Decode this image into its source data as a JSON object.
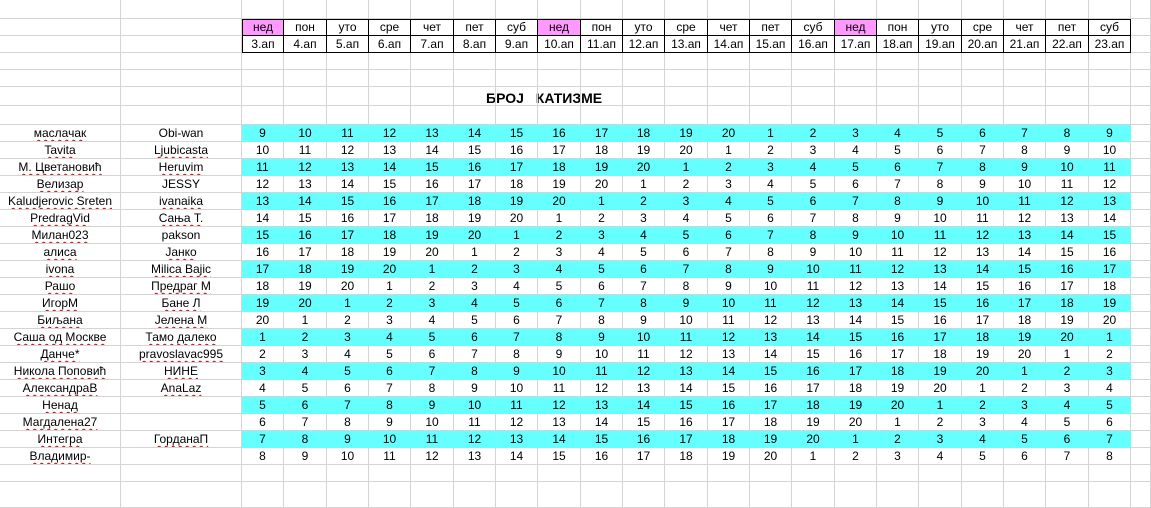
{
  "header": {
    "weekdays": [
      "нед",
      "пон",
      "уто",
      "сре",
      "чет",
      "пет",
      "суб",
      "нед",
      "пон",
      "уто",
      "сре",
      "чет",
      "пет",
      "суб",
      "нед",
      "пон",
      "уто",
      "сре",
      "чет",
      "пет",
      "суб"
    ],
    "dates": [
      "3.ап",
      "4.ап",
      "5.ап",
      "6.ап",
      "7.ап",
      "8.ап",
      "9.ап",
      "10.ап",
      "11.ап",
      "12.ап",
      "13.ап",
      "14.ап",
      "15.ап",
      "16.ап",
      "17.ап",
      "18.ап",
      "19.ап",
      "20.ап",
      "21.ап",
      "22.ап",
      "23.ап"
    ],
    "sunday_color": "#ff99ff"
  },
  "title": "БРОЈ КАТИЗМЕ",
  "colors": {
    "cyan": "#66ffff",
    "grid": "#d4d4d4",
    "spellcheck": "#d00000"
  },
  "rows": [
    {
      "name1": "маслачак",
      "name2": "Obi-wan",
      "start": 9,
      "highlight": true
    },
    {
      "name1": "Tavita",
      "name2": "Ljubicasta",
      "start": 10,
      "highlight": false
    },
    {
      "name1": "М. Цветановић",
      "name2": "Heruvim",
      "start": 11,
      "highlight": true
    },
    {
      "name1": "Велизар",
      "name2": "JESSY",
      "start": 12,
      "highlight": false
    },
    {
      "name1": "Kaludjerovic Sreten",
      "name2": "ivanaika",
      "start": 13,
      "highlight": true
    },
    {
      "name1": "PredragVid",
      "name2": "Сања Т.",
      "start": 14,
      "highlight": false
    },
    {
      "name1": "Милан023",
      "name2": "pakson",
      "start": 15,
      "highlight": true
    },
    {
      "name1": "алиса",
      "name2": "Јанко",
      "start": 16,
      "highlight": false
    },
    {
      "name1": "ivona",
      "name2": "Milica Bajic",
      "start": 17,
      "highlight": true
    },
    {
      "name1": "Рашо",
      "name2": "Предраг М",
      "start": 18,
      "highlight": false
    },
    {
      "name1": "ИгорМ",
      "name2": "Бане Л",
      "start": 19,
      "highlight": true
    },
    {
      "name1": "Биљана",
      "name2": "Јелена М",
      "start": 20,
      "highlight": false
    },
    {
      "name1": "Саша од Москве",
      "name2": "Тамо далеко",
      "start": 1,
      "highlight": true
    },
    {
      "name1": "Данче*",
      "name2": "pravoslavac995",
      "start": 2,
      "highlight": false
    },
    {
      "name1": "Никола Поповић",
      "name2": "НИНЕ",
      "start": 3,
      "highlight": true
    },
    {
      "name1": "АлександраВ",
      "name2": "AnaLaz",
      "start": 4,
      "highlight": false
    },
    {
      "name1": "Ненад",
      "name2": "",
      "start": 5,
      "highlight": true
    },
    {
      "name1": "Магдалена27",
      "name2": "",
      "start": 6,
      "highlight": false
    },
    {
      "name1": "Интегра",
      "name2": "ГорданаП",
      "start": 7,
      "highlight": true
    },
    {
      "name1": "Владимир-",
      "name2": "",
      "start": 8,
      "highlight": false
    }
  ]
}
